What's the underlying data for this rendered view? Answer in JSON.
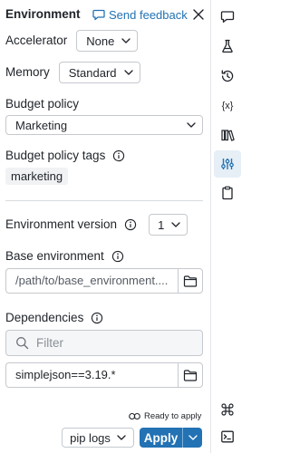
{
  "header": {
    "title": "Environment",
    "feedback_label": "Send feedback"
  },
  "accelerator": {
    "label": "Accelerator",
    "value": "None"
  },
  "memory": {
    "label": "Memory",
    "value": "Standard"
  },
  "budget_policy": {
    "label": "Budget policy",
    "value": "Marketing"
  },
  "budget_policy_tags": {
    "label": "Budget policy tags",
    "tags": [
      "marketing"
    ]
  },
  "environment_version": {
    "label": "Environment version",
    "value": "1"
  },
  "base_environment": {
    "label": "Base environment",
    "value": "/path/to/base_environment...."
  },
  "dependencies": {
    "label": "Dependencies",
    "filter_placeholder": "Filter",
    "items": [
      "simplejson==3.19.*"
    ]
  },
  "footer": {
    "status": "Ready to apply",
    "pip_logs_label": "pip logs",
    "apply_label": "Apply"
  },
  "rail": {
    "icons": [
      "comment-icon",
      "flask-icon",
      "history-icon",
      "variables-icon",
      "library-icon",
      "environment-sliders-icon",
      "clipboard-icon",
      "command-icon",
      "terminal-icon"
    ],
    "active": "environment-sliders-icon"
  },
  "colors": {
    "accent": "#2272b4",
    "text": "#1f2329",
    "border": "#c4c9cf",
    "active_rail": "#e6eef6"
  }
}
